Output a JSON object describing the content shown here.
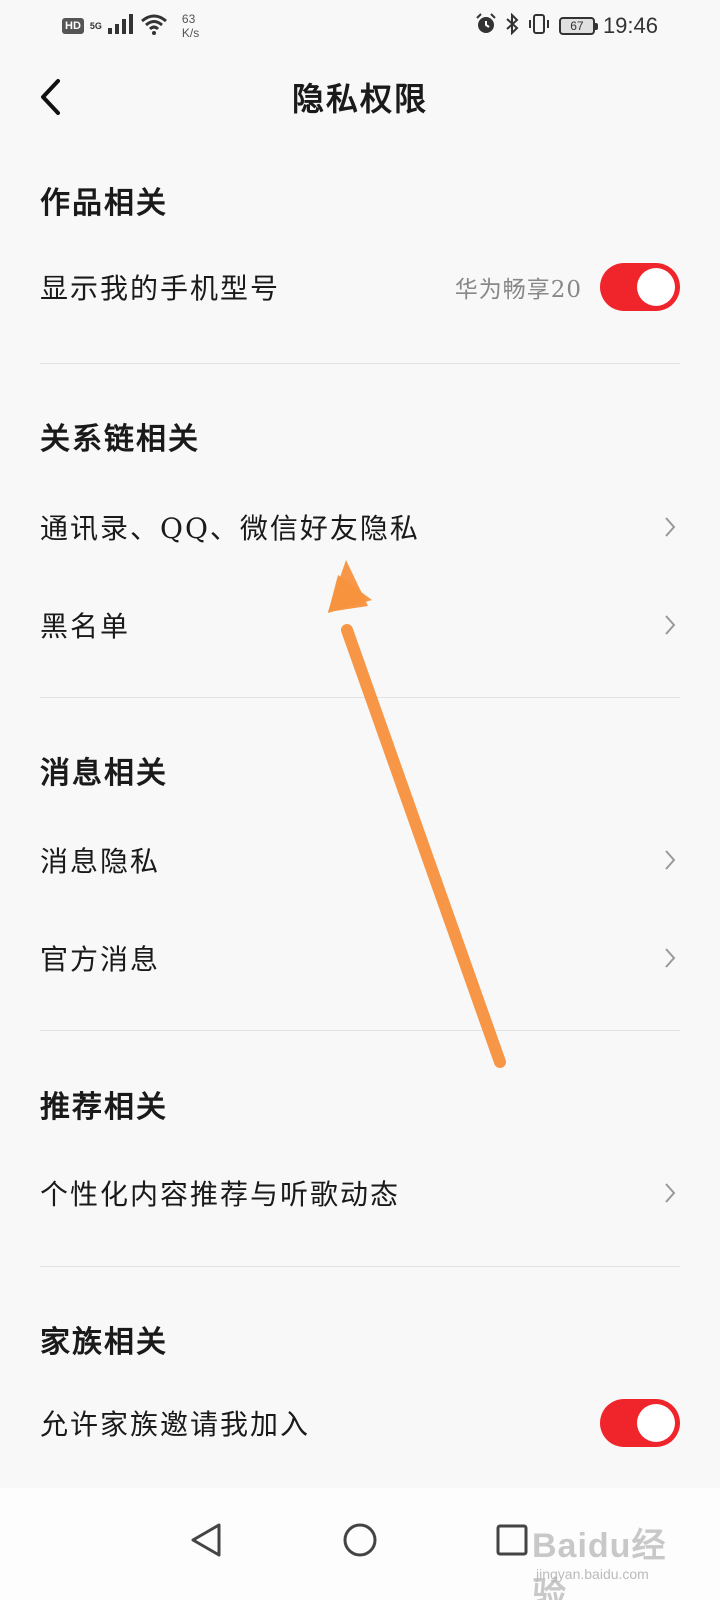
{
  "status_bar": {
    "hd": "HD",
    "network": "5G",
    "speed_value": "63",
    "speed_unit": "K/s",
    "battery": "67",
    "time": "19:46"
  },
  "header": {
    "title": "隐私权限"
  },
  "sections": [
    {
      "title": "作品相关",
      "rows": [
        {
          "label": "显示我的手机型号",
          "value": "华为畅享20",
          "control": "toggle",
          "on": true
        }
      ]
    },
    {
      "title": "关系链相关",
      "rows": [
        {
          "label": "通讯录、QQ、微信好友隐私",
          "control": "chevron"
        },
        {
          "label": "黑名单",
          "control": "chevron"
        }
      ]
    },
    {
      "title": "消息相关",
      "rows": [
        {
          "label": "消息隐私",
          "control": "chevron"
        },
        {
          "label": "官方消息",
          "control": "chevron"
        }
      ]
    },
    {
      "title": "推荐相关",
      "rows": [
        {
          "label": "个性化内容推荐与听歌动态",
          "control": "chevron"
        }
      ]
    },
    {
      "title": "家族相关",
      "rows": [
        {
          "label": "允许家族邀请我加入",
          "control": "toggle",
          "on": true
        }
      ]
    }
  ],
  "colors": {
    "toggle_on": "#f0252b",
    "annotation_arrow": "#f7913d"
  },
  "watermark": {
    "main": "Baidu经验",
    "sub": "jingyan.baidu.com"
  }
}
